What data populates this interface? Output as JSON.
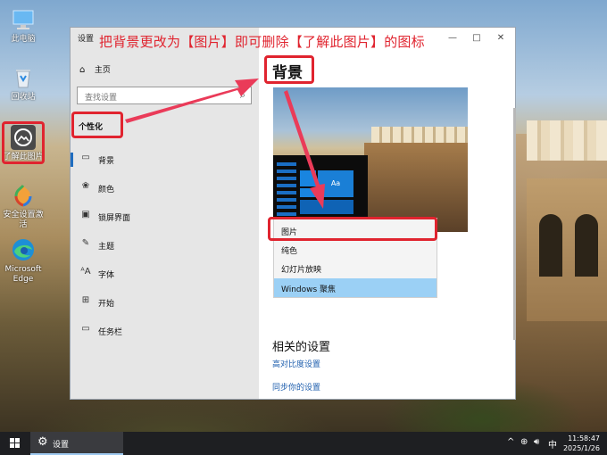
{
  "desktop": {
    "icons": [
      {
        "label": "此电脑",
        "icon": "computer-icon"
      },
      {
        "label": "回收站",
        "icon": "recycle-bin-icon"
      },
      {
        "label": "了解此图片",
        "icon": "learn-about-picture-icon"
      },
      {
        "label": "安全设置激活",
        "icon": "security-activation-icon"
      },
      {
        "label": "Microsoft Edge",
        "icon": "edge-icon"
      }
    ]
  },
  "annotation": "把背景更改为【图片】即可删除【了解此图片】的图标",
  "window": {
    "title": "设置",
    "controls": {
      "minimize": "—",
      "maximize": "□",
      "close": "✕"
    },
    "sidebar": {
      "home_label": "主页",
      "search_placeholder": "查找设置",
      "category": "个性化",
      "items": [
        {
          "label": "背景",
          "icon": "picture-icon",
          "selected": true
        },
        {
          "label": "颜色",
          "icon": "palette-icon"
        },
        {
          "label": "锁屏界面",
          "icon": "lock-screen-icon"
        },
        {
          "label": "主题",
          "icon": "theme-icon"
        },
        {
          "label": "字体",
          "icon": "font-icon"
        },
        {
          "label": "开始",
          "icon": "start-icon"
        },
        {
          "label": "任务栏",
          "icon": "taskbar-icon"
        }
      ]
    },
    "main": {
      "heading": "背景",
      "preview_tile_text": "Aa",
      "dropdown_options": [
        {
          "label": "图片",
          "highlighted": true
        },
        {
          "label": "纯色"
        },
        {
          "label": "幻灯片放映"
        },
        {
          "label": "Windows 聚焦",
          "active": true
        }
      ],
      "related_heading": "相关的设置",
      "links": [
        "高对比度设置",
        "同步你的设置"
      ]
    }
  },
  "taskbar": {
    "app_label": "设置",
    "tray": {
      "chevron": "^",
      "ime": "中"
    },
    "time": "11:58:47",
    "date": "2025/1/26"
  },
  "colors": {
    "accent": "#1f6dbf",
    "highlight": "#e0242f",
    "dropdown_active": "#9bd0f5"
  }
}
